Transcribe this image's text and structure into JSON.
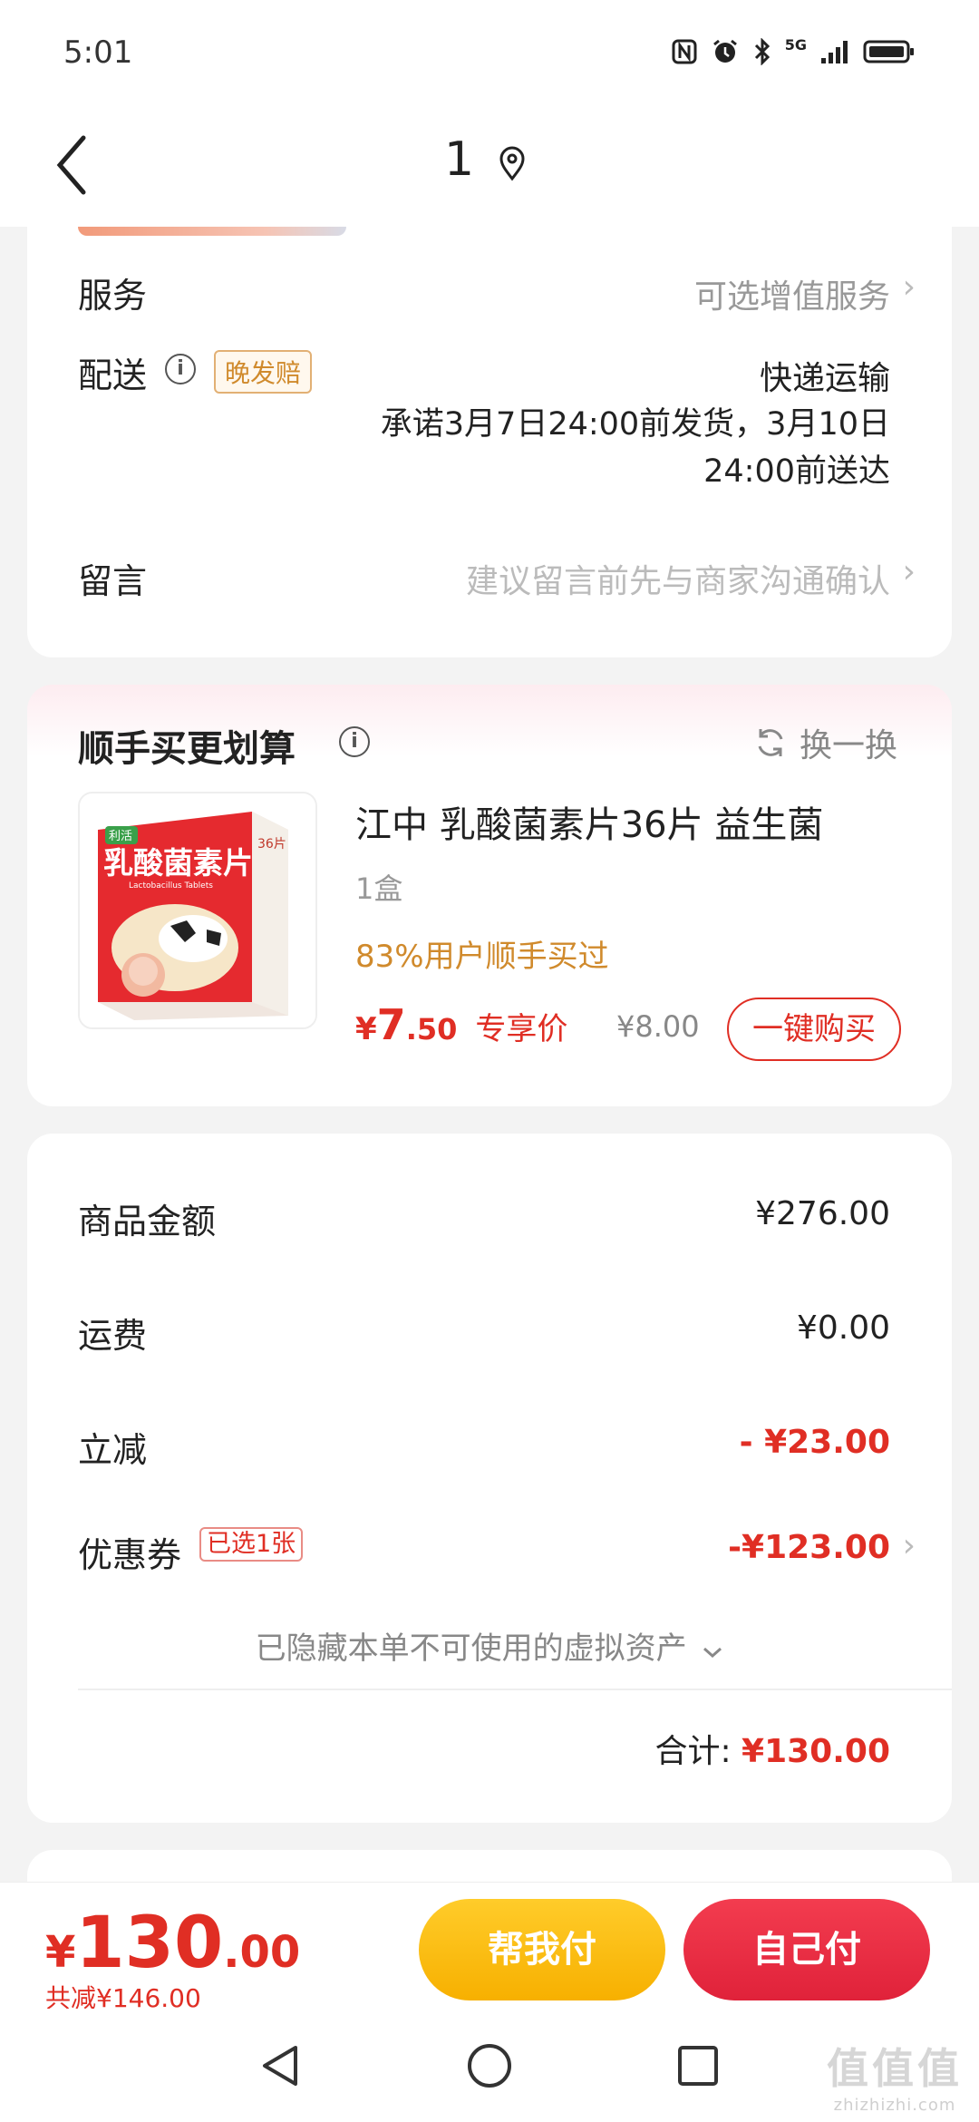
{
  "status": {
    "time": "5:01",
    "network": "5G"
  },
  "nav": {
    "title": "1"
  },
  "order": {
    "service_label": "服务",
    "service_value": "可选增值服务",
    "delivery_label": "配送",
    "late_tag": "晚发赔",
    "delivery_type": "快递运输",
    "delivery_promise": "承诺3月7日24:00前发货，3月10日24:00前送达",
    "message_label": "留言",
    "message_placeholder": "建议留言前先与商家沟通确认"
  },
  "upsell": {
    "title": "顺手买更划算",
    "swap_label": "换一换",
    "product": {
      "name": "江中 乳酸菌素片36片 益生菌",
      "qty": "1盒",
      "bought": "83%用户顺手买过",
      "price_currency": "¥",
      "price_int": "7",
      "price_dec": ".50",
      "price_label": "专享价",
      "orig_price": "¥8.00",
      "buy_label": "一键购买",
      "box_text": "乳酸菌素片",
      "box_brand": "利活",
      "box_sub": "Lactobacillus Tablets",
      "box_count": "36片"
    }
  },
  "summary": {
    "goods_label": "商品金额",
    "goods_value": "¥276.00",
    "shipping_label": "运费",
    "shipping_value": "¥0.00",
    "discount_label": "立减",
    "discount_value": "- ¥23.00",
    "coupon_label": "优惠券",
    "coupon_tag": "已选1张",
    "coupon_value": "-¥123.00",
    "hidden_assets": "已隐藏本单不可使用的虚拟资产",
    "total_label": "合计:",
    "total_value": "¥130.00"
  },
  "bottom": {
    "price_currency": "¥",
    "price_int": "130",
    "price_dec": ".00",
    "saved": "共减¥146.00",
    "help_pay": "帮我付",
    "self_pay": "自己付"
  },
  "watermark": {
    "main": "值值值",
    "sub": "zhizhizhi.com"
  },
  "colors": {
    "accent_red": "#e02e24",
    "accent_yellow": "#f7b000",
    "orange_text": "#d08a2c"
  }
}
